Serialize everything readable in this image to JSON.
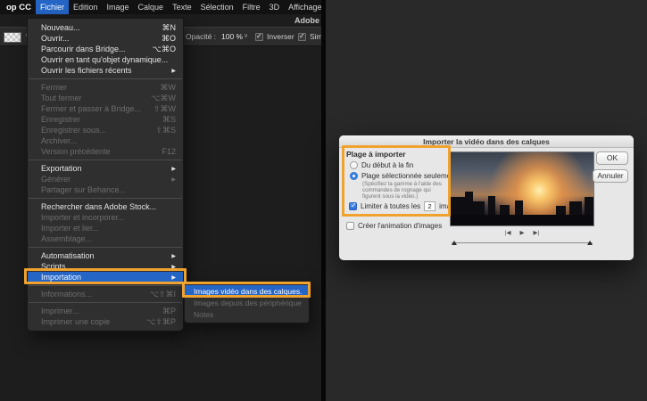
{
  "icons": {
    "submenu_arrow": "▶",
    "dropdown_chevron": "∨",
    "prev_frame": "|◀",
    "play": "▶",
    "next_frame": "▶|"
  },
  "menubar": {
    "app_label": "op CC",
    "active_item": "Fichier",
    "items": [
      "Fichier",
      "Edition",
      "Image",
      "Calque",
      "Texte",
      "Sélection",
      "Filtre",
      "3D",
      "Affichage"
    ]
  },
  "window": {
    "title_fragment": "Adobe"
  },
  "options_bar": {
    "opacity_label": "Opacité :",
    "opacity_value": "100 %",
    "inverser_label": "Inverser",
    "sim_label": "Sim"
  },
  "file_menu": {
    "items": [
      {
        "label": "Nouveau...",
        "shortcut": "⌘N"
      },
      {
        "label": "Ouvrir...",
        "shortcut": "⌘O"
      },
      {
        "label": "Parcourir dans Bridge...",
        "shortcut": "⌥⌘O"
      },
      {
        "label": "Ouvrir en tant qu'objet dynamique..."
      },
      {
        "label": "Ouvrir les fichiers récents",
        "submenu": true
      },
      {
        "separator": true
      },
      {
        "label": "Fermer",
        "shortcut": "⌘W",
        "disabled": true
      },
      {
        "label": "Tout fermer",
        "shortcut": "⌥⌘W",
        "disabled": true
      },
      {
        "label": "Fermer et passer à Bridge...",
        "shortcut": "⇧⌘W",
        "disabled": true
      },
      {
        "label": "Enregistrer",
        "shortcut": "⌘S",
        "disabled": true
      },
      {
        "label": "Enregistrer sous...",
        "shortcut": "⇧⌘S",
        "disabled": true
      },
      {
        "label": "Archiver...",
        "disabled": true
      },
      {
        "label": "Version précédente",
        "shortcut": "F12",
        "disabled": true
      },
      {
        "separator": true
      },
      {
        "label": "Exportation",
        "submenu": true
      },
      {
        "label": "Générer",
        "submenu": true,
        "disabled": true
      },
      {
        "label": "Partager sur Behance...",
        "disabled": true
      },
      {
        "separator": true
      },
      {
        "label": "Rechercher dans Adobe Stock..."
      },
      {
        "label": "Importer et incorporer...",
        "disabled": true
      },
      {
        "label": "Importer et lier...",
        "disabled": true
      },
      {
        "label": "Assemblage...",
        "disabled": true
      },
      {
        "separator": true
      },
      {
        "label": "Automatisation",
        "submenu": true
      },
      {
        "label": "Scripts",
        "submenu": true
      },
      {
        "label": "Importation",
        "submenu": true,
        "selected": true
      },
      {
        "separator": true
      },
      {
        "label": "Informations...",
        "shortcut": "⌥⇧⌘I",
        "disabled": true
      },
      {
        "separator": true
      },
      {
        "label": "Imprimer...",
        "shortcut": "⌘P",
        "disabled": true
      },
      {
        "label": "Imprimer une copie",
        "shortcut": "⌥⇧⌘P",
        "disabled": true
      }
    ]
  },
  "import_submenu": {
    "items": [
      {
        "label": "Images vidéo dans des calques...",
        "selected": true
      },
      {
        "label": "Images depuis des périphériques",
        "disabled": true
      },
      {
        "label": "Notes",
        "disabled": true
      }
    ]
  },
  "dialog": {
    "title": "Importer la vidéo dans des calques",
    "range_label": "Plage à importer",
    "radio_full": "Du début à la fin",
    "radio_selected": "Plage sélectionnée seulement",
    "radio_hint": "(Spécifiez la gamme à l'aide des commandes de rognage qui figurent sous la vidéo.)",
    "limit_label": "Limiter à toutes les",
    "limit_value": "2",
    "limit_unit": "images",
    "frame_anim_label": "Créer l'animation d'images",
    "ok_label": "OK",
    "cancel_label": "Annuler"
  }
}
